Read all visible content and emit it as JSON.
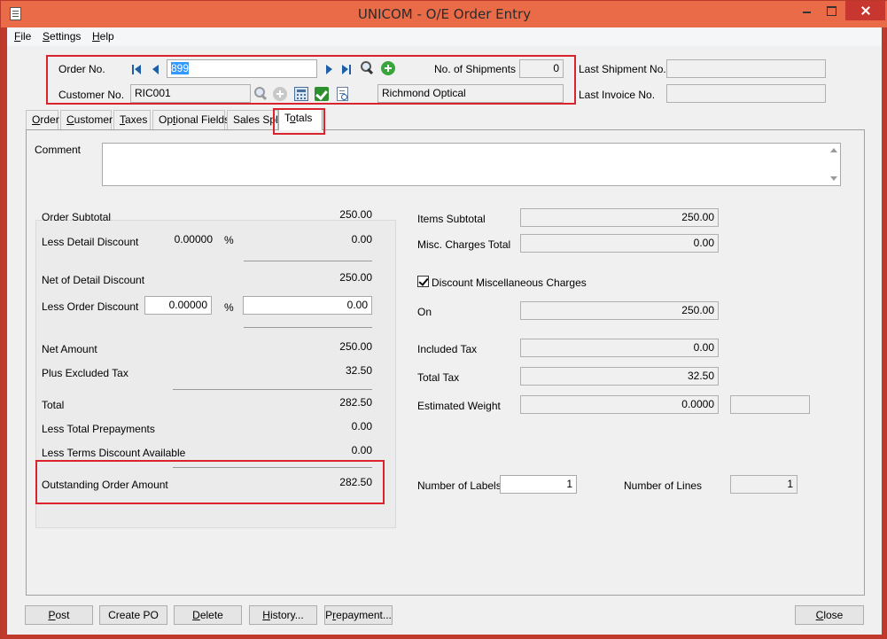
{
  "window": {
    "title": "UNICOM - O/E Order Entry"
  },
  "menu": [
    {
      "prefix": "",
      "hotkey": "F",
      "rest": "ile"
    },
    {
      "prefix": "",
      "hotkey": "S",
      "rest": "ettings"
    },
    {
      "prefix": "",
      "hotkey": "H",
      "rest": "elp"
    }
  ],
  "header": {
    "order_no_label": "Order No.",
    "order_no_value": "899",
    "customer_no_label": "Customer No.",
    "customer_no_value": "RIC001",
    "customer_name": "Richmond Optical",
    "shipments_label": "No. of Shipments",
    "shipments_value": "0",
    "last_shipment_label": "Last Shipment No.",
    "last_shipment_value": "",
    "last_invoice_label": "Last Invoice No.",
    "last_invoice_value": ""
  },
  "tabs": [
    {
      "prefix": "",
      "hotkey": "O",
      "rest": "rder"
    },
    {
      "prefix": "",
      "hotkey": "C",
      "rest": "ustomer"
    },
    {
      "prefix": "",
      "hotkey": "T",
      "rest": "axes"
    },
    {
      "prefix": "Op",
      "hotkey": "t",
      "rest": "ional Fields"
    },
    {
      "prefix": "Sales Spli",
      "hotkey": "",
      "rest": ""
    },
    {
      "prefix": "T",
      "hotkey": "o",
      "rest": "tals"
    }
  ],
  "comment": {
    "label": "Comment",
    "value": ""
  },
  "left": {
    "order_subtotal_label": "Order Subtotal",
    "order_subtotal": "250.00",
    "less_detail_discount_label": "Less Detail Discount",
    "detail_discount_pct": "0.00000",
    "pct_symbol": "%",
    "detail_discount": "0.00",
    "net_detail_discount_label": "Net of Detail Discount",
    "net_detail_discount": "250.00",
    "less_order_discount_label": "Less Order Discount",
    "order_discount_pct": "0.00000",
    "order_discount": "0.00",
    "net_amount_label": "Net Amount",
    "net_amount": "250.00",
    "plus_excluded_tax_label": "Plus Excluded Tax",
    "plus_excluded_tax": "32.50",
    "total_label": "Total",
    "total": "282.50",
    "less_prepayments_label": "Less Total Prepayments",
    "less_prepayments": "0.00",
    "less_terms_discount_label": "Less Terms Discount Available",
    "less_terms_discount": "0.00",
    "outstanding_label": "Outstanding Order Amount",
    "outstanding": "282.50"
  },
  "right": {
    "items_subtotal_label": "Items Subtotal",
    "items_subtotal": "250.00",
    "misc_charges_label": "Misc. Charges Total",
    "misc_charges": "0.00",
    "discount_misc_label": "Discount Miscellaneous Charges",
    "discount_misc_checked": true,
    "on_label": "On",
    "on_value": "250.00",
    "included_tax_label": "Included Tax",
    "included_tax": "0.00",
    "total_tax_label": "Total Tax",
    "total_tax": "32.50",
    "est_weight_label": "Estimated Weight",
    "est_weight": "0.0000",
    "est_weight_unit": "",
    "num_labels_label": "Number of Labels",
    "num_labels": "1",
    "num_lines_label": "Number of Lines",
    "num_lines": "1"
  },
  "buttons": [
    {
      "prefix": "",
      "hotkey": "P",
      "rest": "ost"
    },
    {
      "prefix": "Create PO",
      "hotkey": "",
      "rest": ""
    },
    {
      "prefix": "",
      "hotkey": "D",
      "rest": "elete"
    },
    {
      "prefix": "",
      "hotkey": "H",
      "rest": "istory..."
    },
    {
      "prefix": "P",
      "hotkey": "r",
      "rest": "epayment..."
    },
    {
      "prefix": "",
      "hotkey": "C",
      "rest": "lose"
    }
  ]
}
